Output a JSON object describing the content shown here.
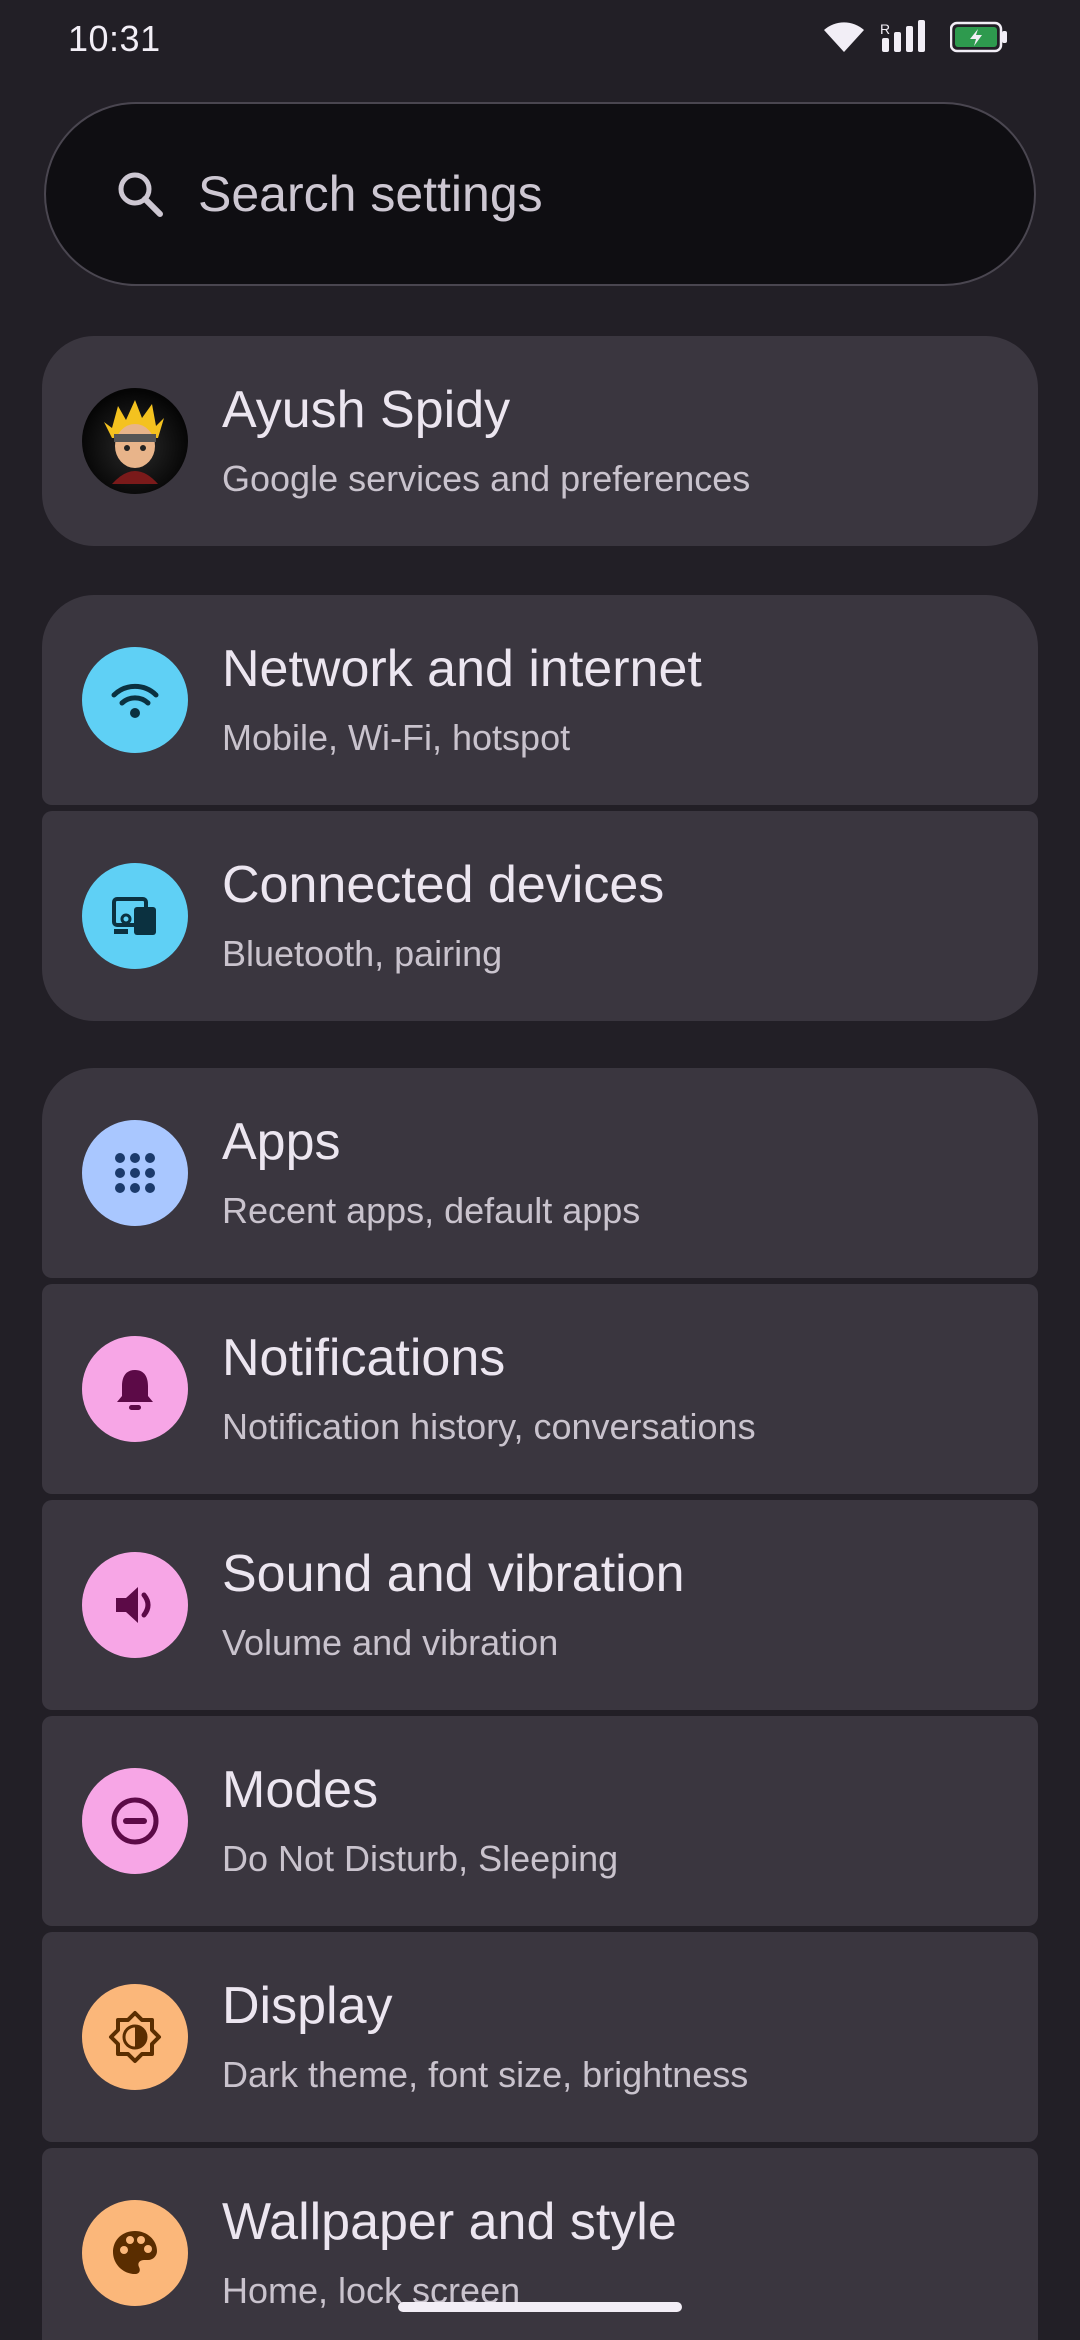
{
  "status_bar": {
    "time": "10:31",
    "icons": [
      "wifi-icon",
      "signal-roaming-icon",
      "battery-charging-icon"
    ]
  },
  "search": {
    "placeholder": "Search settings"
  },
  "account": {
    "name": "Ayush Spidy",
    "subtitle": "Google services and preferences"
  },
  "groups": {
    "connectivity": [
      {
        "title": "Network and internet",
        "subtitle": "Mobile, Wi-Fi, hotspot",
        "icon": "wifi-icon",
        "color": "#5fd0f5"
      },
      {
        "title": "Connected devices",
        "subtitle": "Bluetooth, pairing",
        "icon": "devices-icon",
        "color": "#5fd0f5"
      }
    ],
    "device": [
      {
        "title": "Apps",
        "subtitle": "Recent apps, default apps",
        "icon": "apps-grid-icon",
        "color": "#a9c7ff"
      },
      {
        "title": "Notifications",
        "subtitle": "Notification history, conversations",
        "icon": "bell-icon",
        "color": "#f7a6e6"
      },
      {
        "title": "Sound and vibration",
        "subtitle": "Volume and vibration",
        "icon": "speaker-icon",
        "color": "#f7a6e6"
      },
      {
        "title": "Modes",
        "subtitle": "Do Not Disturb, Sleeping",
        "icon": "minus-circle-icon",
        "color": "#f7a6e6"
      },
      {
        "title": "Display",
        "subtitle": "Dark theme, font size, brightness",
        "icon": "brightness-icon",
        "color": "#fbb77a"
      },
      {
        "title": "Wallpaper and style",
        "subtitle": "Home, lock screen",
        "icon": "palette-icon",
        "color": "#fbb77a"
      }
    ]
  },
  "colors": {
    "background": "#221f26",
    "card": "#3a363f",
    "search_bg": "#0f0e12",
    "text_primary": "#ece6f0",
    "text_secondary": "#c9c3cd",
    "battery": "#2e9a4e"
  }
}
